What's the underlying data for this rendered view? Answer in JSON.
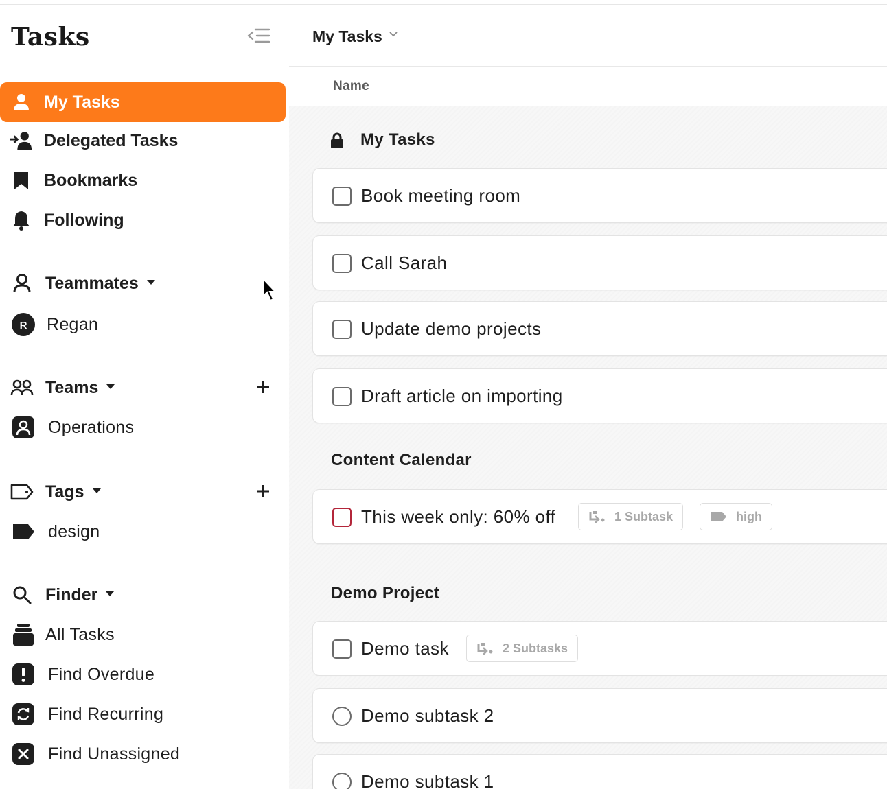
{
  "app": {
    "title": "Tasks"
  },
  "sidebar": {
    "nav": [
      {
        "label": "My Tasks",
        "icon": "person-icon",
        "active": true
      },
      {
        "label": "Delegated Tasks",
        "icon": "delegate-icon"
      },
      {
        "label": "Bookmarks",
        "icon": "bookmark-icon"
      },
      {
        "label": "Following",
        "icon": "bell-icon"
      }
    ],
    "teammates": {
      "label": "Teammates",
      "items": [
        {
          "label": "Regan",
          "avatar_letter": "R"
        }
      ]
    },
    "teams": {
      "label": "Teams",
      "items": [
        {
          "label": "Operations"
        }
      ]
    },
    "tags": {
      "label": "Tags",
      "items": [
        {
          "label": "design"
        }
      ]
    },
    "finder": {
      "label": "Finder",
      "items": [
        {
          "label": "All Tasks",
          "icon": "stack-icon"
        },
        {
          "label": "Find Overdue",
          "icon": "exclamation-icon"
        },
        {
          "label": "Find Recurring",
          "icon": "recurring-icon"
        },
        {
          "label": "Find Unassigned",
          "icon": "x-icon"
        }
      ]
    }
  },
  "main": {
    "title": "My Tasks",
    "column_name": "Name",
    "groups": [
      {
        "title": "My Tasks",
        "tasks": [
          {
            "name": "Book meeting room"
          },
          {
            "name": "Call Sarah"
          },
          {
            "name": "Update demo projects"
          },
          {
            "name": "Draft article on importing"
          }
        ]
      },
      {
        "title": "Content Calendar",
        "tasks": [
          {
            "name": "This week only: 60% off",
            "subtasks": "1 Subtask",
            "tag": "high"
          }
        ]
      },
      {
        "title": "Demo Project",
        "tasks": [
          {
            "name": "Demo task",
            "subtasks": "2 Subtasks"
          },
          {
            "name": "Demo subtask 2"
          },
          {
            "name": "Demo subtask 1"
          }
        ]
      }
    ]
  },
  "colors": {
    "accent": "#fd7a1a",
    "text": "#1f1f1f",
    "muted": "#a8a8a8",
    "danger": "#b3263a"
  }
}
